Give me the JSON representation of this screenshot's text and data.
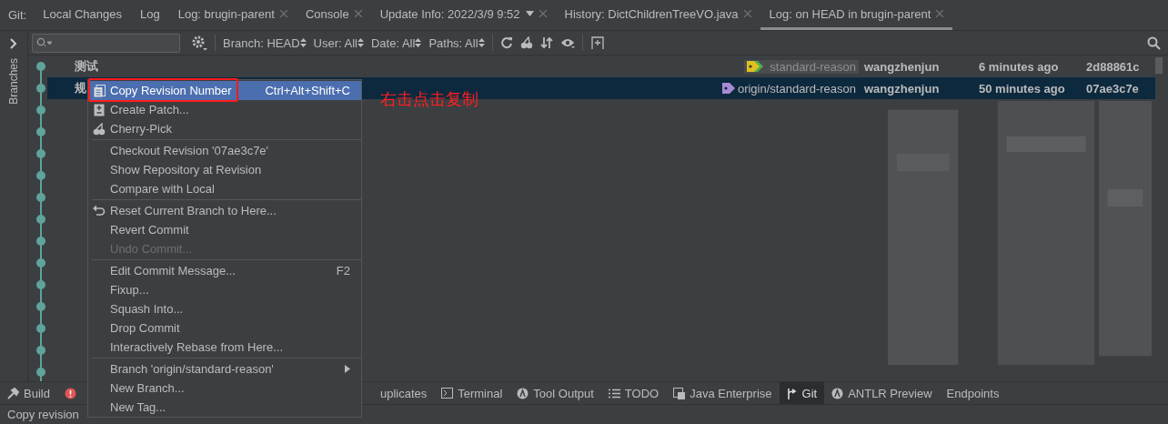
{
  "tool_window": {
    "label": "Git:"
  },
  "tabs": [
    {
      "label": "Local Changes",
      "closable": false,
      "selected": false
    },
    {
      "label": "Log",
      "closable": false,
      "selected": false
    },
    {
      "label": "Log: brugin-parent",
      "closable": true,
      "selected": false
    },
    {
      "label": "Console",
      "closable": true,
      "selected": false
    },
    {
      "label": "Update Info: 2022/3/9 9:52",
      "closable": true,
      "dropdown": true,
      "selected": false
    },
    {
      "label": "History: DictChildrenTreeVO.java",
      "closable": true,
      "selected": false
    },
    {
      "label": "Log: on HEAD in brugin-parent",
      "closable": true,
      "selected": true
    }
  ],
  "side_panel": {
    "label": "Branches"
  },
  "filters": [
    {
      "label": "Branch: HEAD"
    },
    {
      "label": "User: All"
    },
    {
      "label": "Date: All"
    },
    {
      "label": "Paths: All"
    }
  ],
  "commits": [
    {
      "message": "测试",
      "ref": {
        "label": "standard-reason",
        "kind": "local"
      },
      "author": "wangzhenjun",
      "time": "6 minutes ago",
      "hash": "2d88861c",
      "selected": false
    },
    {
      "message": "规",
      "ref": {
        "label": "origin/standard-reason",
        "kind": "remote"
      },
      "author": "wangzhenjun",
      "time": "50 minutes ago",
      "hash": "07ae3c7e",
      "selected": true
    }
  ],
  "context_menu": [
    {
      "label": "Copy Revision Number",
      "shortcut": "Ctrl+Alt+Shift+C",
      "kind": "copy",
      "selected": true,
      "disabled": false
    },
    {
      "label": "Create Patch...",
      "kind": "patch",
      "selected": false,
      "disabled": false
    },
    {
      "label": "Cherry-Pick",
      "kind": "cherry",
      "selected": false,
      "disabled": false
    },
    {
      "label": "Checkout Revision '07ae3c7e'",
      "separator": true,
      "selected": false,
      "disabled": false
    },
    {
      "label": "Show Repository at Revision",
      "selected": false,
      "disabled": false
    },
    {
      "label": "Compare with Local",
      "selected": false,
      "disabled": false
    },
    {
      "label": "Reset Current Branch to Here...",
      "kind": "reset",
      "separator": true,
      "selected": false,
      "disabled": false
    },
    {
      "label": "Revert Commit",
      "selected": false,
      "disabled": false
    },
    {
      "label": "Undo Commit...",
      "selected": false,
      "disabled": true
    },
    {
      "label": "Edit Commit Message...",
      "shortcut": "F2",
      "separator": true,
      "selected": false,
      "disabled": false
    },
    {
      "label": "Fixup...",
      "selected": false,
      "disabled": false
    },
    {
      "label": "Squash Into...",
      "selected": false,
      "disabled": false
    },
    {
      "label": "Drop Commit",
      "selected": false,
      "disabled": false
    },
    {
      "label": "Interactively Rebase from Here...",
      "selected": false,
      "disabled": false
    },
    {
      "label": "Branch 'origin/standard-reason'",
      "submenu": true,
      "separator": true,
      "selected": false,
      "disabled": false
    },
    {
      "label": "New Branch...",
      "selected": false,
      "disabled": false
    },
    {
      "label": "New Tag...",
      "selected": false,
      "disabled": false
    }
  ],
  "annotation": {
    "label": "右击点击复制"
  },
  "bottom_tools": [
    {
      "label": "Build",
      "kind": "hammer",
      "selected": false
    },
    {
      "kind": "problems",
      "selected": false
    },
    {
      "label": "uplicates",
      "selected": false
    },
    {
      "label": "Terminal",
      "kind": "terminal",
      "selected": false
    },
    {
      "label": "Tool Output",
      "kind": "antlr",
      "selected": false
    },
    {
      "label": "TODO",
      "kind": "list",
      "selected": false
    },
    {
      "label": "Java Enterprise",
      "kind": "javaee",
      "selected": false
    },
    {
      "label": "Git",
      "kind": "git",
      "selected": true
    },
    {
      "label": "ANTLR Preview",
      "kind": "antlr",
      "selected": false
    },
    {
      "label": "Endpoints",
      "selected": false
    }
  ],
  "status_bar": {
    "text": "Copy revision"
  }
}
